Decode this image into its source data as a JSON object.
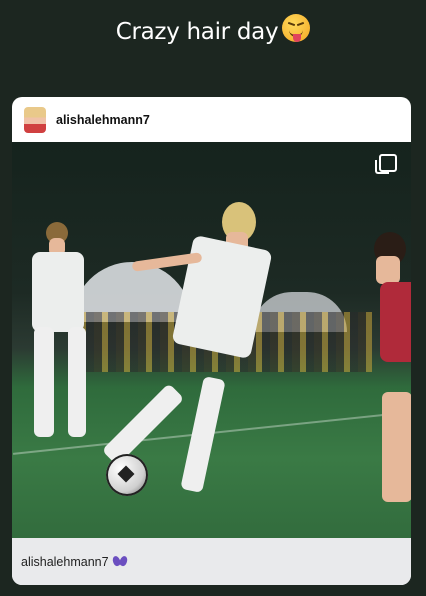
{
  "story": {
    "caption_text": "Crazy hair day",
    "caption_emoji": "squinting-face-with-tongue-emoji"
  },
  "post": {
    "username": "alishalehmann7",
    "footer_username": "alishalehmann7",
    "footer_emoji": "hands-emoji",
    "media_type_icon": "multiple-photos-icon"
  },
  "colors": {
    "background": "#1c2620",
    "card": "#ffffff",
    "footer": "#e9eaec"
  }
}
